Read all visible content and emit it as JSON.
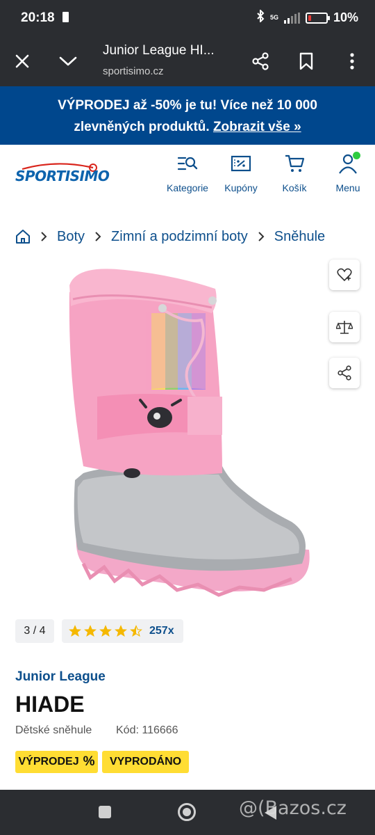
{
  "status_bar": {
    "time": "20:18",
    "network": "5G",
    "battery": "10%",
    "battery_level": 0.1
  },
  "browser": {
    "title": "Junior League HI...",
    "domain": "sportisimo.cz",
    "icons": [
      "close-icon",
      "chevron-down-icon",
      "share-icon",
      "bookmark-icon",
      "more-icon"
    ]
  },
  "promo": {
    "line1": "VÝPRODEJ až -50% je tu! Více než 10 000",
    "line2_text": "zlevněných produktů.",
    "line2_link": "Zobrazit vše »"
  },
  "header": {
    "logo_text": "SPORTISIMO",
    "nav": [
      {
        "label": "Kategorie",
        "icon": "category-search-icon"
      },
      {
        "label": "Kupóny",
        "icon": "coupon-icon"
      },
      {
        "label": "Košík",
        "icon": "cart-icon"
      },
      {
        "label": "Menu",
        "icon": "user-icon"
      }
    ],
    "accent": "#0d4f8c",
    "online_dot": "#2ecc40"
  },
  "breadcrumb": {
    "home_icon": "home-icon",
    "items": [
      "Boty",
      "Zimní a podzimní boty",
      "Sněhule"
    ]
  },
  "product": {
    "image_pager": "3 / 4",
    "rating": 4.5,
    "rating_max": 5,
    "review_count": "257x",
    "brand": "Junior League",
    "name": "HIADE",
    "category": "Dětské sněhule",
    "code": "Kód: 116666",
    "badges": [
      "VÝPRODEJ",
      "VYPRODÁNO"
    ],
    "badge_color": "#ffdd33",
    "side_actions": [
      "wishlist-heart-icon",
      "compare-scale-icon",
      "share-icon"
    ]
  },
  "watermark": "@(Bazos.cz"
}
